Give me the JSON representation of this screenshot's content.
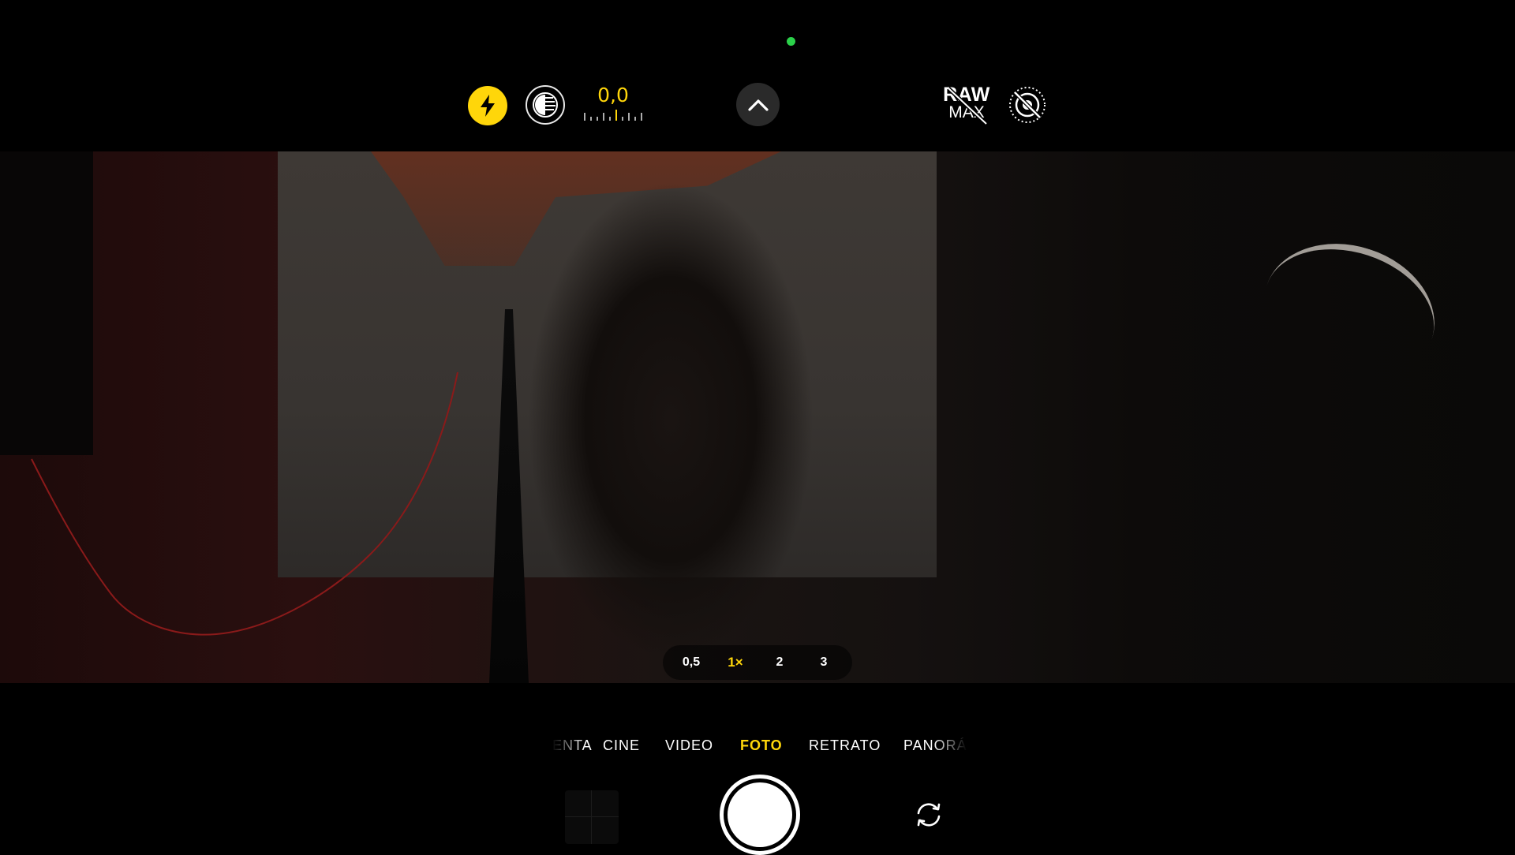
{
  "top_bar": {
    "exposure_value": "0,0",
    "raw": {
      "top": "RAW",
      "bottom": "MAX"
    }
  },
  "zoom": {
    "options": [
      "0,5",
      "1×",
      "2",
      "3"
    ],
    "selected": "1×"
  },
  "modes": {
    "items": [
      "ENTA",
      "CINE",
      "VIDEO",
      "FOTO",
      "RETRATO",
      "PANORÁMI"
    ],
    "selected": "FOTO"
  },
  "colors": {
    "accent": "#ffd60a",
    "recording_indicator": "#2bd14a"
  },
  "icons": {
    "flash": "flash-icon",
    "photographic_styles": "photographic-styles-icon",
    "more_controls": "chevron-up-icon",
    "live_photo_off": "live-photo-off-icon",
    "flip_camera": "flip-camera-icon"
  }
}
